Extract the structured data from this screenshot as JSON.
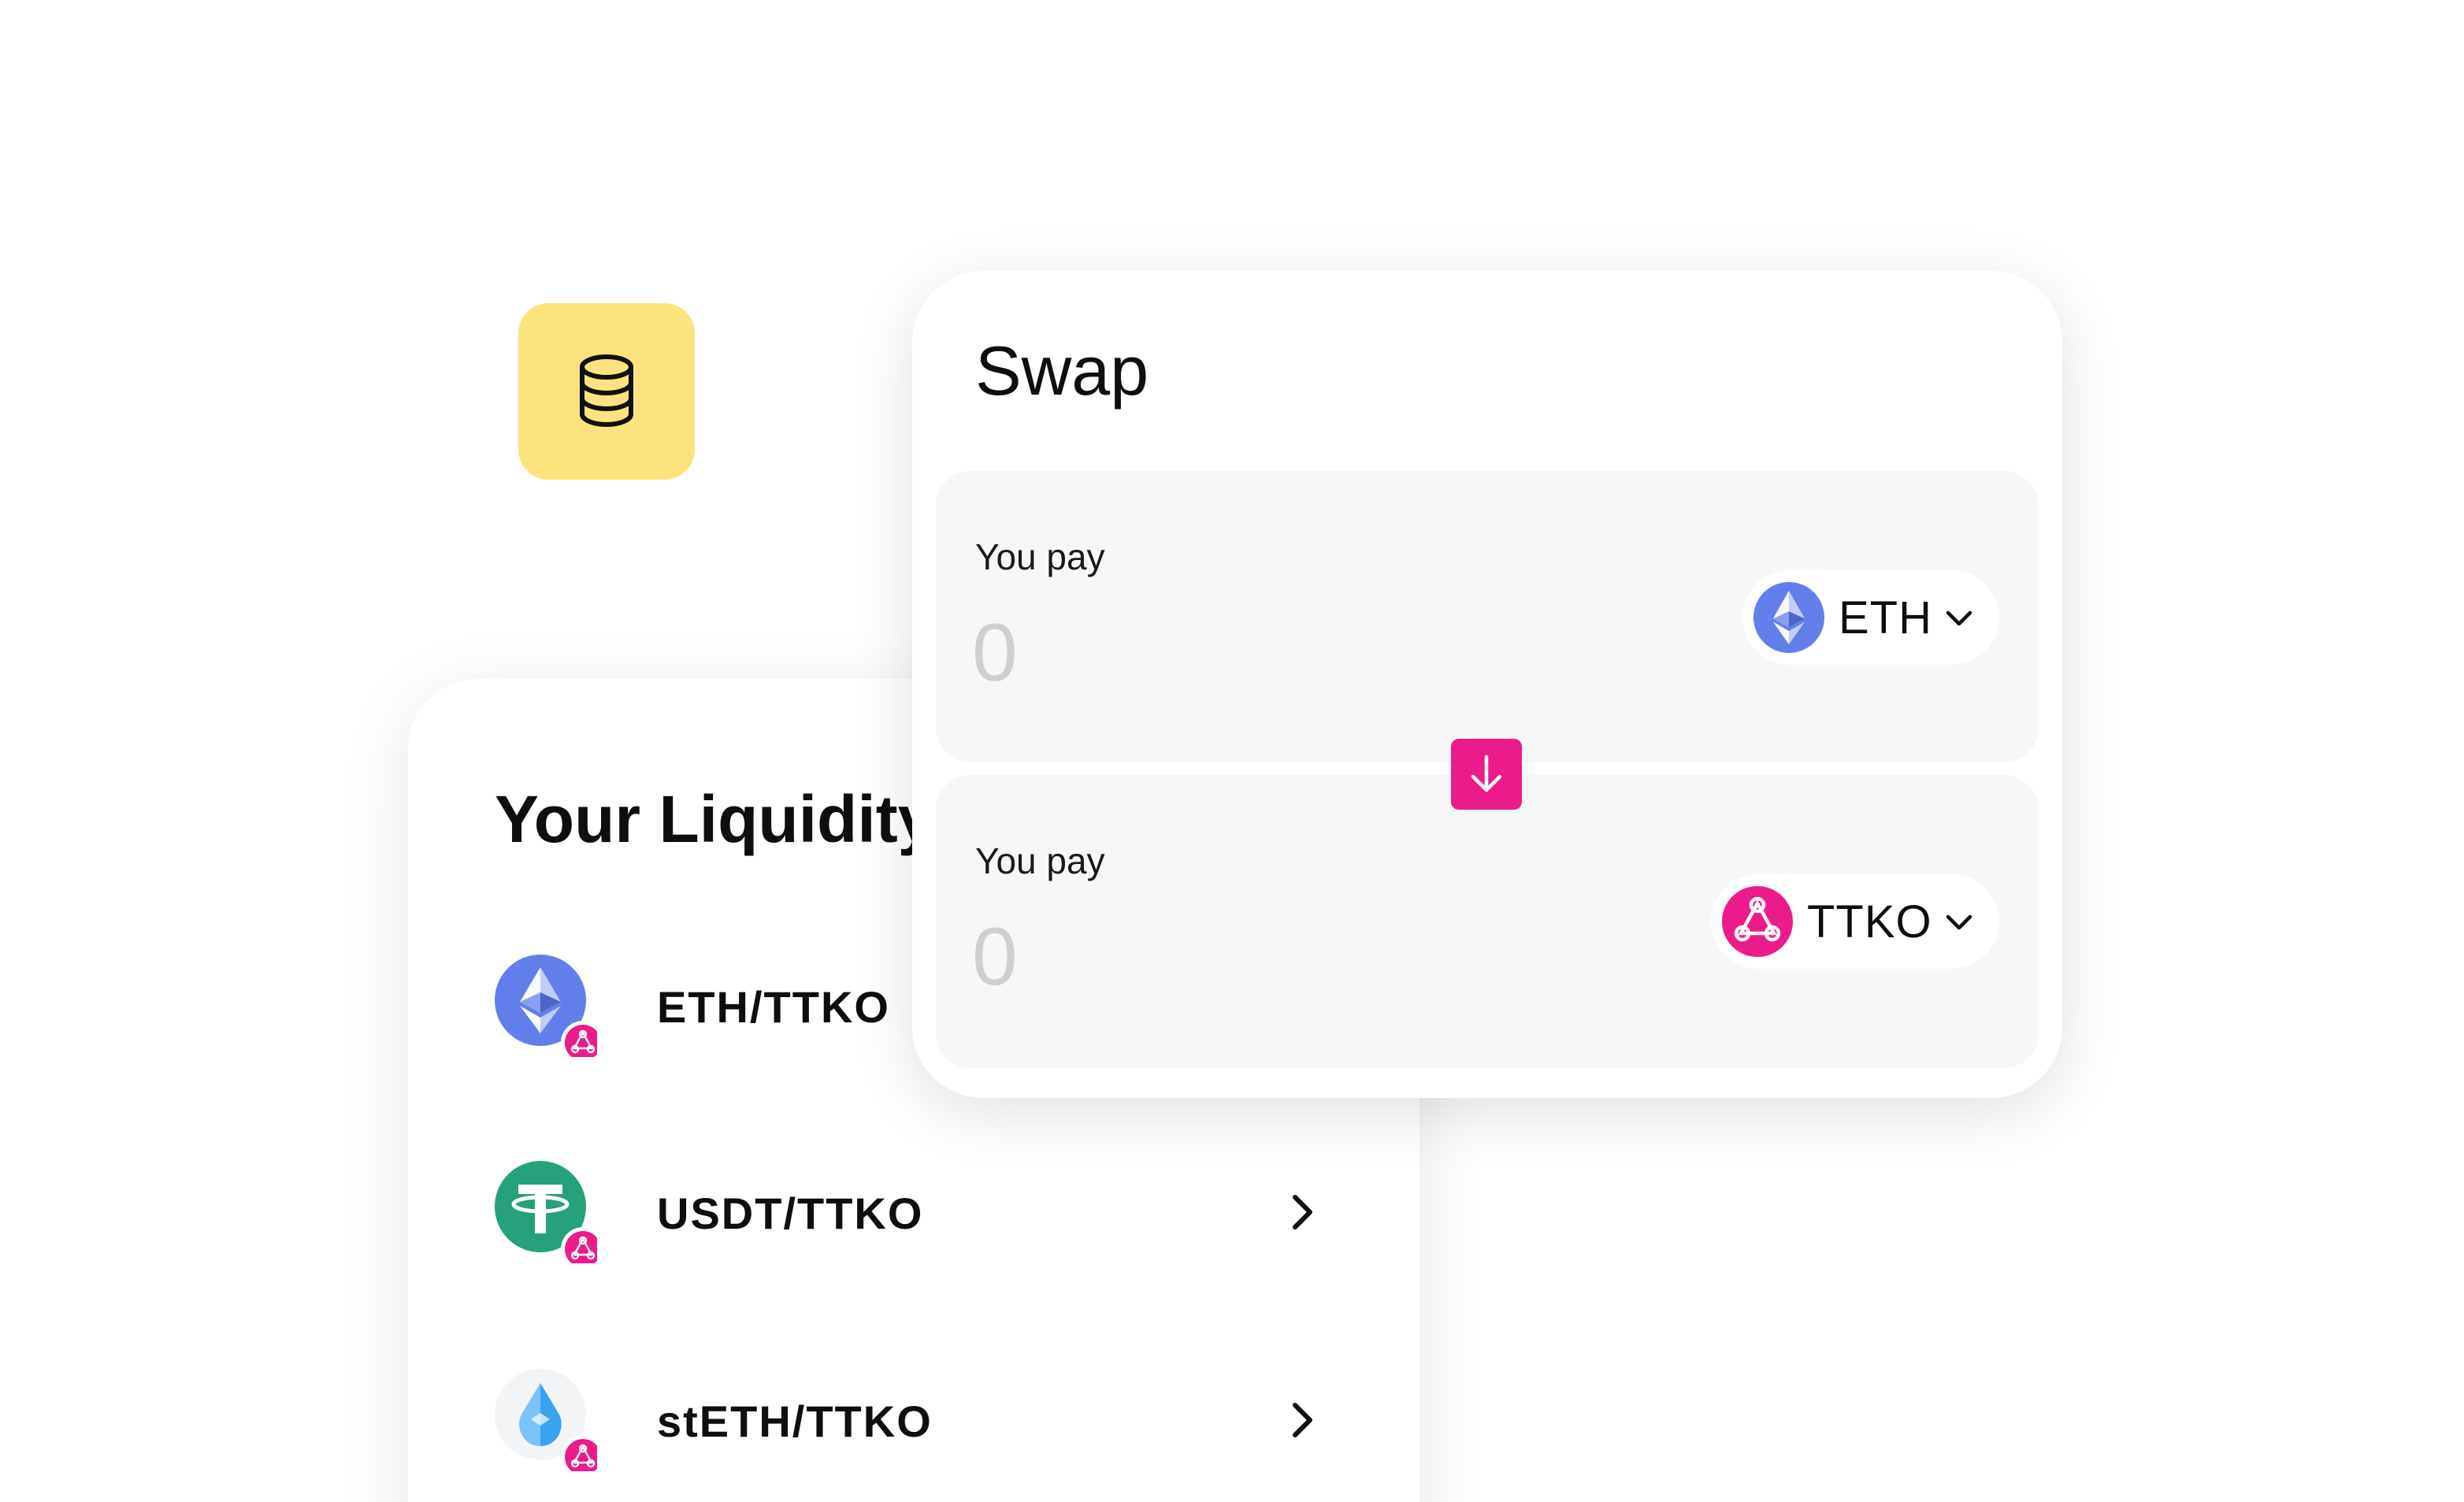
{
  "colors": {
    "accent_pink": "#ec1b8c",
    "eth_blue": "#627eea",
    "usdt_green": "#26a17b",
    "coin_badge_yellow": "#fde37e"
  },
  "coin_badge": {
    "icon": "coins-stack-icon"
  },
  "liquidity": {
    "title": "Your Liquidity",
    "pairs": [
      {
        "label": "ETH/TTKO",
        "icon": "eth-icon"
      },
      {
        "label": "USDT/TTKO",
        "icon": "usdt-icon"
      },
      {
        "label": "stETH/TTKO",
        "icon": "steth-icon"
      }
    ]
  },
  "swap": {
    "title": "Swap",
    "pay": {
      "label": "You pay",
      "amount": "0",
      "token": "ETH"
    },
    "receive": {
      "label": "You pay",
      "amount": "0",
      "token": "TTKO"
    },
    "switch_icon": "arrow-down-icon"
  }
}
